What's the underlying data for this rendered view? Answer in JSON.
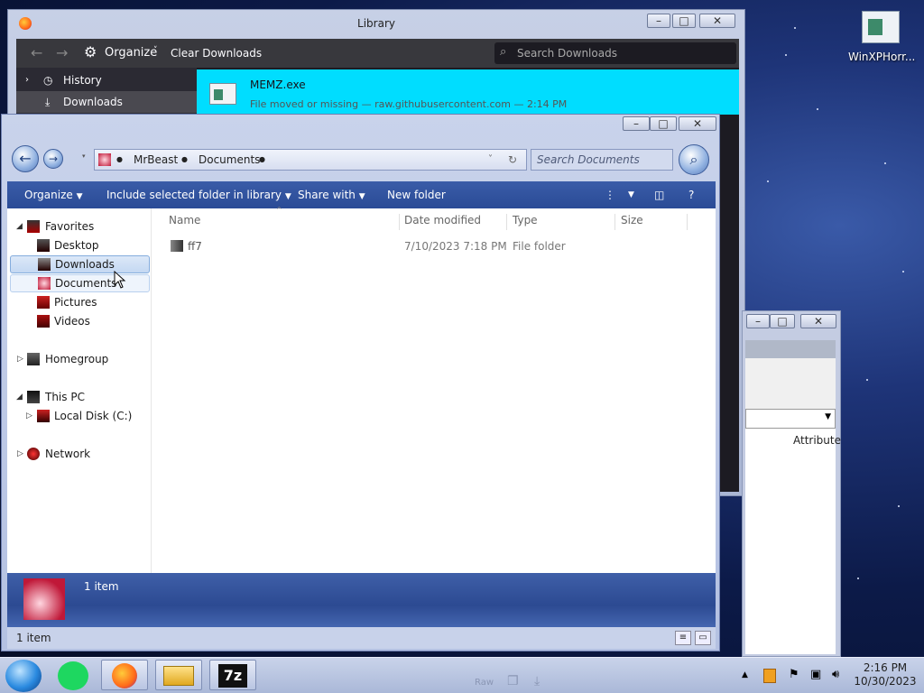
{
  "desktop": {
    "icon_label": "WinXPHorr..."
  },
  "library": {
    "title": "Library",
    "organize_label": "Organize",
    "clear_downloads_label": "Clear Downloads",
    "search_placeholder": "Search Downloads",
    "sidebar": [
      {
        "label": "History"
      },
      {
        "label": "Downloads"
      }
    ],
    "download": {
      "name": "MEMZ.exe",
      "status": "File moved or missing — raw.githubusercontent.com — 2:14 PM"
    }
  },
  "properties": {
    "column": "Attribute"
  },
  "explorer": {
    "breadcrumb": [
      "MrBeast",
      "Documents"
    ],
    "search_placeholder": "Search Documents",
    "commands": {
      "organize": "Organize",
      "include": "Include selected folder in library",
      "share": "Share with",
      "new_folder": "New folder"
    },
    "tree": {
      "favorites": "Favorites",
      "desktop": "Desktop",
      "downloads": "Downloads",
      "documents": "Documents",
      "pictures": "Pictures",
      "videos": "Videos",
      "homegroup": "Homegroup",
      "this_pc": "This PC",
      "local_disk": "Local Disk (C:)",
      "network": "Network"
    },
    "columns": {
      "name": "Name",
      "date": "Date modified",
      "type": "Type",
      "size": "Size"
    },
    "rows": [
      {
        "name": "ff7",
        "date": "7/10/2023 7:18 PM",
        "type": "File folder",
        "size": ""
      }
    ],
    "details_count": "1 item",
    "status_count": "1 item"
  },
  "taskbar": {
    "ghost_label": "Raw",
    "time": "2:16 PM",
    "date": "10/30/2023"
  },
  "colors": {
    "firefox_accent": "#00ddff",
    "explorer_command_bar": "#2a4b96"
  }
}
